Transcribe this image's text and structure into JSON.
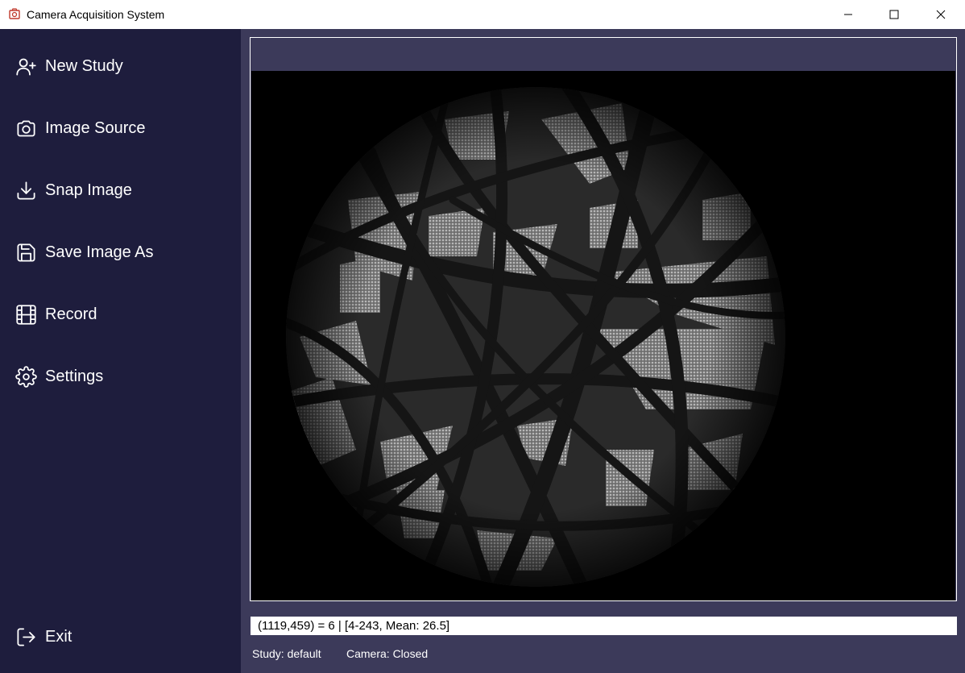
{
  "window": {
    "title": "Camera Acquisition System",
    "controls": [
      "minimize",
      "maximize",
      "close"
    ]
  },
  "sidebar": {
    "items": [
      {
        "label": "New Study",
        "icon": "add-user-icon"
      },
      {
        "label": "Image Source",
        "icon": "camera-icon"
      },
      {
        "label": "Snap Image",
        "icon": "download-icon"
      },
      {
        "label": "Save Image As",
        "icon": "save-icon"
      },
      {
        "label": "Record",
        "icon": "film-icon"
      },
      {
        "label": "Settings",
        "icon": "gear-icon"
      }
    ],
    "exit": {
      "label": "Exit",
      "icon": "exit-icon"
    }
  },
  "viewer": {
    "pixel_info": "(1119,459) = 6 | [4-243, Mean: 26.5]"
  },
  "status": {
    "study": "Study: default",
    "camera": "Camera: Closed"
  },
  "colors": {
    "sidebar_bg": "#1e1d3d",
    "main_bg": "#3c3a5a",
    "image_bg": "#000000",
    "text": "#ffffff"
  }
}
